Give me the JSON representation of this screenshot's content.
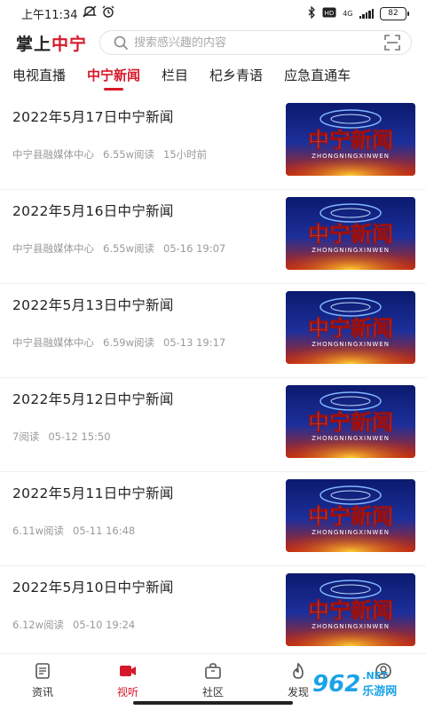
{
  "status_bar": {
    "time": "上午11:34",
    "network": "4G",
    "battery": "82"
  },
  "header": {
    "brand_part1": "掌上",
    "brand_part2": "中宁",
    "search_placeholder": "搜索感兴趣的内容"
  },
  "tabs": [
    {
      "label": "电视直播"
    },
    {
      "label": "中宁新闻"
    },
    {
      "label": "栏目"
    },
    {
      "label": "杞乡青语"
    },
    {
      "label": "应急直通车"
    }
  ],
  "active_tab": "中宁新闻",
  "news": [
    {
      "title": "2022年5月17日中宁新闻",
      "source": "中宁县融媒体中心",
      "reads": "6.55w阅读",
      "time": "15小时前",
      "thumb_text": "中宁新闻",
      "thumb_sub": "ZHONGNINGXINWEN"
    },
    {
      "title": "2022年5月16日中宁新闻",
      "source": "中宁县融媒体中心",
      "reads": "6.55w阅读",
      "time": "05-16 19:07",
      "thumb_text": "中宁新闻",
      "thumb_sub": "ZHONGNINGXINWEN"
    },
    {
      "title": "2022年5月13日中宁新闻",
      "source": "中宁县融媒体中心",
      "reads": "6.59w阅读",
      "time": "05-13 19:17",
      "thumb_text": "中宁新闻",
      "thumb_sub": "ZHONGNINGXINWEN"
    },
    {
      "title": "2022年5月12日中宁新闻",
      "source": "",
      "reads": "7阅读",
      "time": "05-12 15:50",
      "thumb_text": "中宁新闻",
      "thumb_sub": "ZHONGNINGXINWEN"
    },
    {
      "title": "2022年5月11日中宁新闻",
      "source": "",
      "reads": "6.11w阅读",
      "time": "05-11 16:48",
      "thumb_text": "中宁新闻",
      "thumb_sub": "ZHONGNINGXINWEN"
    },
    {
      "title": "2022年5月10日中宁新闻",
      "source": "",
      "reads": "6.12w阅读",
      "time": "05-10 19:24",
      "thumb_text": "中宁新闻",
      "thumb_sub": "ZHONGNINGXINWEN"
    }
  ],
  "bottom_nav": [
    {
      "label": "资讯",
      "icon": "news-icon"
    },
    {
      "label": "视听",
      "icon": "video-icon"
    },
    {
      "label": "社区",
      "icon": "bag-icon"
    },
    {
      "label": "发现",
      "icon": "flame-icon"
    },
    {
      "label": "",
      "icon": "user-icon"
    }
  ],
  "active_nav": "视听",
  "watermark": {
    "logo": "962",
    "net": ".NET",
    "cn": "乐游网"
  },
  "colors": {
    "accent": "#d7182a",
    "text": "#222222",
    "meta": "#9a9a9a",
    "watermark": "#1aa3e8"
  }
}
